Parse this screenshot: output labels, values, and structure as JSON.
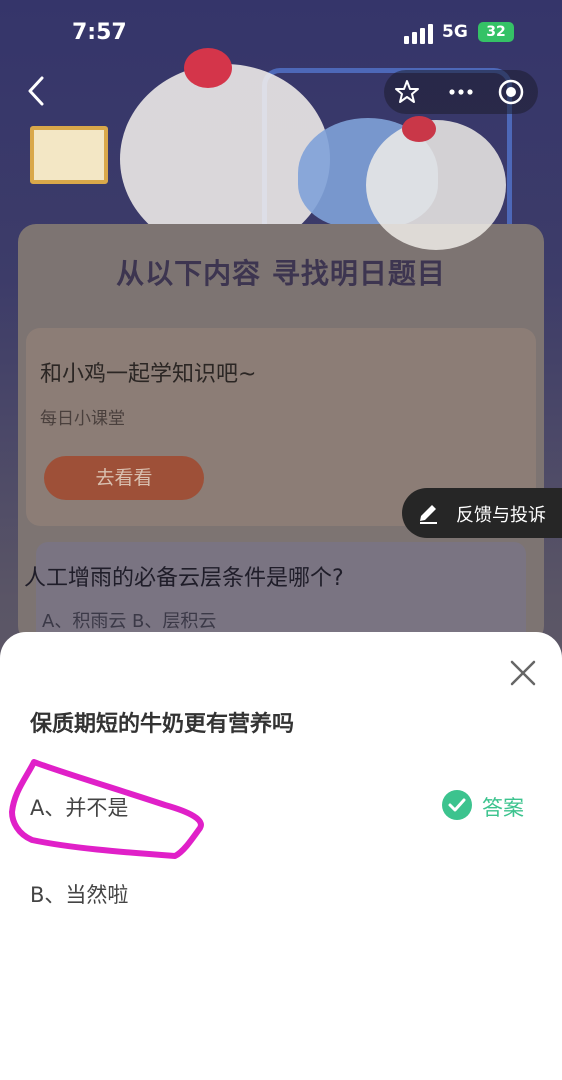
{
  "status_bar": {
    "time": "7:57",
    "network": "5G",
    "battery": "32"
  },
  "icons": {
    "back": "chevron-left-icon",
    "favorite": "star-add-icon",
    "more": "more-dots-icon",
    "mini_program_close": "target-circle-icon",
    "feedback": "edit-pen-icon",
    "close": "close-x-icon",
    "answer_check": "check-circle-icon"
  },
  "card": {
    "title": "从以下内容 寻找明日题目",
    "learn_title": "和小鸡一起学知识吧~",
    "learn_subtitle": "每日小课堂",
    "learn_button": "去看看",
    "question_text": "人工增雨的必备云层条件是哪个?",
    "question_options": "A、积雨云    B、层积云"
  },
  "feedback_button": "反馈与投诉",
  "sheet": {
    "question": "保质期短的牛奶更有营养吗",
    "option_a": "A、并不是",
    "option_b": "B、当然啦",
    "answer_label": "答案"
  },
  "colors": {
    "accent_green": "#3cc38e",
    "highlight_magenta": "#e020c8",
    "learn_button": "#9e5038"
  }
}
